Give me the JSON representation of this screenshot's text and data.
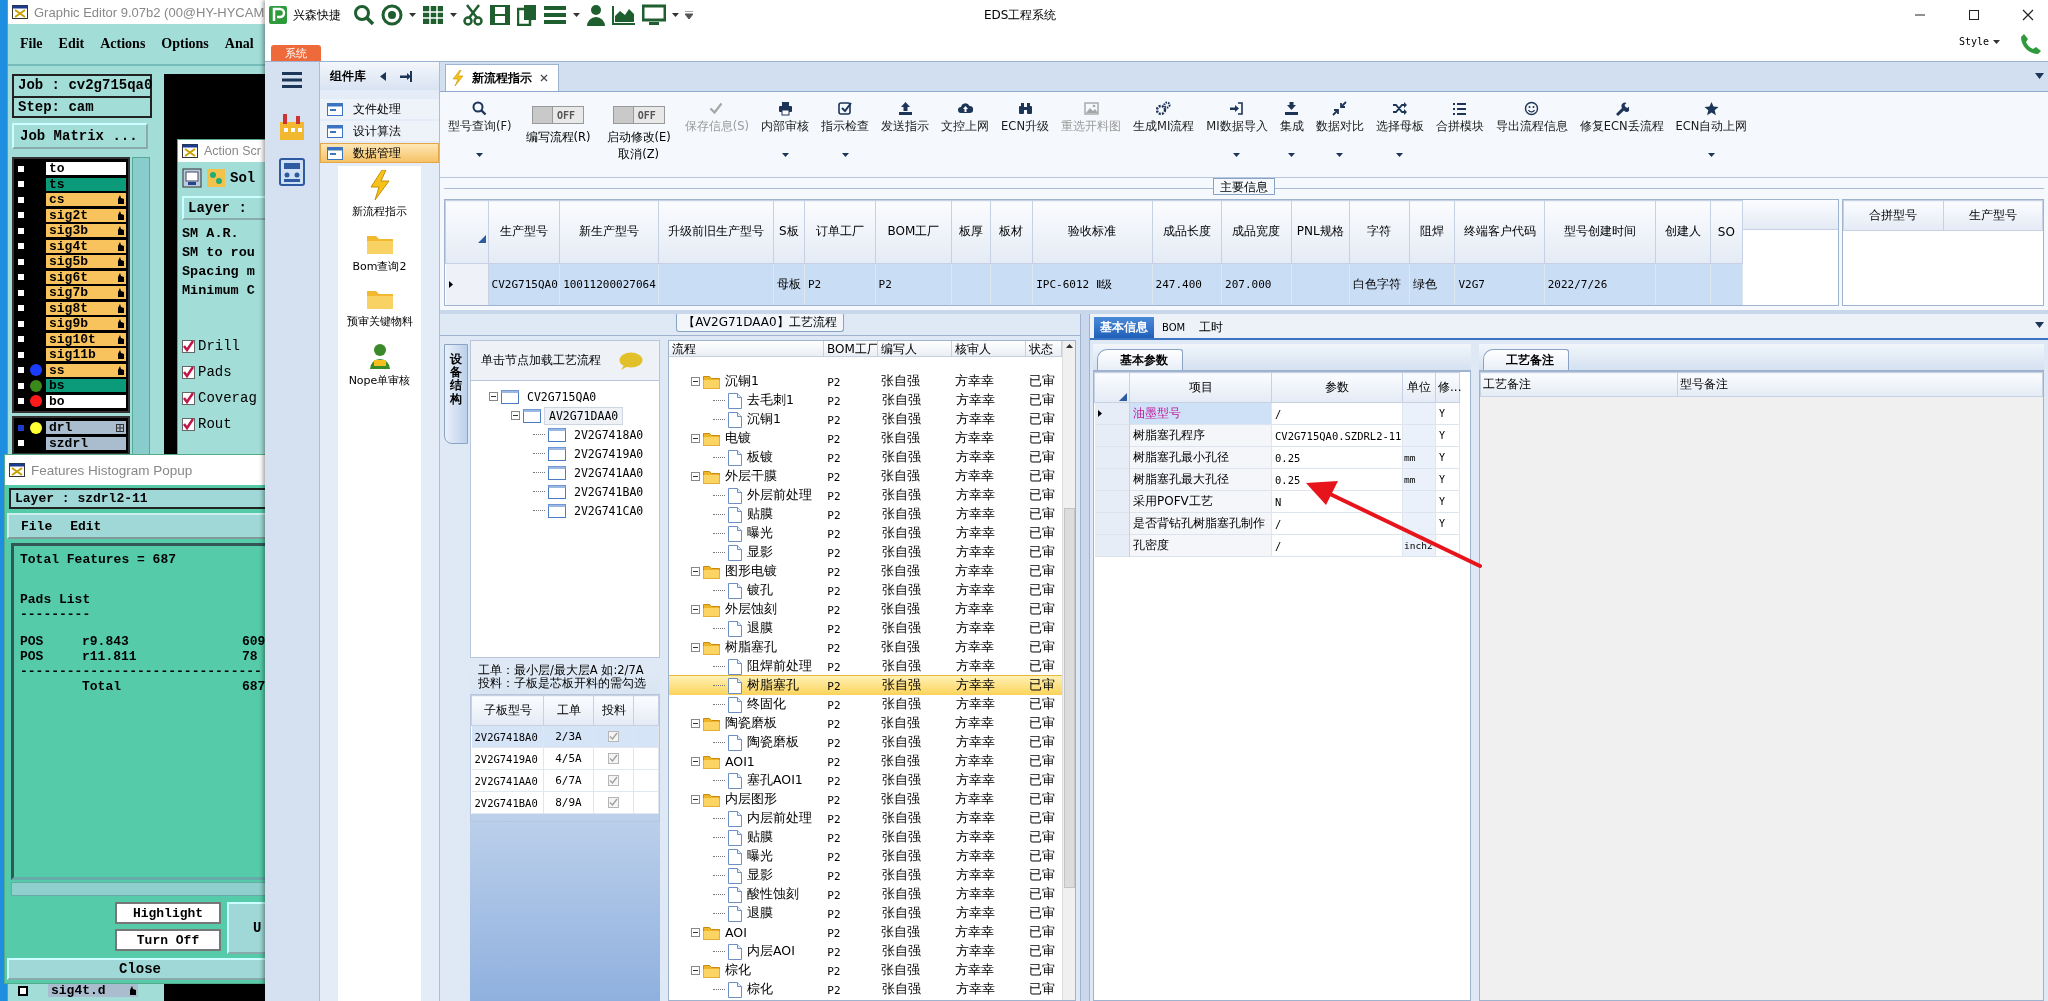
{
  "graphic_editor": {
    "title": "Graphic Editor 9.07b2 (00@HY-HYCAM",
    "menu": [
      "File",
      "Edit",
      "Actions",
      "Options",
      "Anal"
    ],
    "job": "Job : cv2g715qa0",
    "step": "Step: cam",
    "job_matrix_button": "Job Matrix ...",
    "layers": [
      {
        "name": "to",
        "color": "#ffffff",
        "kind": "plain",
        "selected": false
      },
      {
        "name": "ts",
        "color": "#0b9b7a",
        "kind": "plain",
        "selected": false
      },
      {
        "name": "cs",
        "color": "#f8c35c",
        "kind": "signal",
        "selected": false
      },
      {
        "name": "sig2t",
        "color": "#f8c35c",
        "kind": "signal",
        "selected": false
      },
      {
        "name": "sig3b",
        "color": "#f8c35c",
        "kind": "signal",
        "selected": false
      },
      {
        "name": "sig4t",
        "color": "#f8c35c",
        "kind": "signal",
        "selected": false
      },
      {
        "name": "sig5b",
        "color": "#f8c35c",
        "kind": "signal",
        "selected": false
      },
      {
        "name": "sig6t",
        "color": "#f8c35c",
        "kind": "signal",
        "selected": false
      },
      {
        "name": "sig7b",
        "color": "#f8c35c",
        "kind": "signal",
        "selected": false
      },
      {
        "name": "sig8t",
        "color": "#f8c35c",
        "kind": "signal",
        "selected": false
      },
      {
        "name": "sig9b",
        "color": "#f8c35c",
        "kind": "signal",
        "selected": false
      },
      {
        "name": "sig10t",
        "color": "#f8c35c",
        "kind": "signal",
        "selected": false
      },
      {
        "name": "sig11b",
        "color": "#f8c35c",
        "kind": "signal",
        "selected": false
      },
      {
        "name": "ss",
        "color": "#f8c35c",
        "dot": {
          "color": "#1a3cff"
        },
        "kind": "signal",
        "selected": false
      },
      {
        "name": "bs",
        "color": "#0b9b7a",
        "dot": {
          "color": "#3a8a1a"
        },
        "kind": "plain",
        "selected": false
      },
      {
        "name": "bo",
        "color": "#ffffff",
        "dot": {
          "color": "#ff1a1a"
        },
        "kind": "plain",
        "selected": false
      }
    ],
    "drill_layers": [
      {
        "name": "drl",
        "color": "#aabdcf",
        "dot": {
          "color": "#ffff33"
        },
        "kind": "drill",
        "selected": true
      },
      {
        "name": "szdrl",
        "color": "#aabdcf",
        "kind": "plain",
        "selected": false
      }
    ],
    "bottom_layer": {
      "name": "sig4t.d",
      "color": "#aabdcf",
      "kind": "signal",
      "selected": false
    }
  },
  "action_script": {
    "title": "Action Scr",
    "tool_label": "Sol",
    "layer_label": "Layer :",
    "lines": [
      "SM A.R.",
      "SM to rou",
      "Spacing m",
      "Minimum C"
    ],
    "options": [
      {
        "label": "Drill",
        "checked": true
      },
      {
        "label": "Pads",
        "checked": true
      },
      {
        "label": "Coverag",
        "checked": true
      },
      {
        "label": "Rout",
        "checked": true
      }
    ]
  },
  "histogram": {
    "title": "Features Histogram Popup",
    "layer": "Layer :  szdrl2-11",
    "menu": [
      "File",
      "Edit"
    ],
    "total": "Total Features = 687",
    "section": "Pads List",
    "underline": "---------",
    "rows": [
      {
        "type": "POS",
        "size": "r9.843",
        "count": "609"
      },
      {
        "type": "POS",
        "size": "r11.811",
        "count": "78"
      }
    ],
    "separator": "-------------------------------",
    "total_label": "Total",
    "total_count": "687",
    "buttons": [
      "Highlight",
      "Turn Off"
    ],
    "side_button": "U",
    "close_button": "Close"
  },
  "eds": {
    "quick_bar_label": "兴森快捷",
    "title": "EDS工程系统",
    "system_tab": "系统",
    "style_menu": "Style",
    "component_library": {
      "title": "组件库",
      "categories": [
        {
          "label": "文件处理",
          "selected": false
        },
        {
          "label": "设计算法",
          "selected": false
        },
        {
          "label": "数据管理",
          "selected": true
        }
      ],
      "tools": [
        {
          "label": "新流程指示"
        },
        {
          "label": "Bom查询2"
        },
        {
          "label": "预审关键物料"
        },
        {
          "label": "Nope单审核"
        }
      ]
    },
    "doc_tabs": [
      {
        "label": "新流程指示",
        "selected": true
      }
    ],
    "toolbar": [
      {
        "kind": "button",
        "label": "型号查询(F)",
        "dropdown": true,
        "disabled": false
      },
      {
        "kind": "toggle",
        "label": "编写流程(R)",
        "state_label": "OFF",
        "on": false
      },
      {
        "kind": "toggle",
        "label": "启动修改(E)",
        "sublabel": "取消(Z)",
        "state_label": "OFF",
        "on": false
      },
      {
        "kind": "button",
        "label": "保存信息(S)",
        "dropdown": false,
        "disabled": true
      },
      {
        "kind": "button",
        "label": "内部审核",
        "dropdown": true,
        "disabled": false
      },
      {
        "kind": "button",
        "label": "指示检查",
        "dropdown": true,
        "disabled": false
      },
      {
        "kind": "button",
        "label": "发送指示",
        "dropdown": false,
        "disabled": false
      },
      {
        "kind": "button",
        "label": "文控上网",
        "dropdown": false,
        "disabled": false
      },
      {
        "kind": "button",
        "label": "ECN升级",
        "dropdown": false,
        "disabled": false
      },
      {
        "kind": "button",
        "label": "重选开料图",
        "dropdown": false,
        "disabled": true
      },
      {
        "kind": "button",
        "label": "生成MI流程",
        "dropdown": false,
        "disabled": false
      },
      {
        "kind": "button",
        "label": "MI数据导入",
        "dropdown": true,
        "disabled": false
      },
      {
        "kind": "button",
        "label": "集成",
        "dropdown": true,
        "disabled": false
      },
      {
        "kind": "button",
        "label": "数据对比",
        "dropdown": true,
        "disabled": false
      },
      {
        "kind": "button",
        "label": "选择母板",
        "dropdown": true,
        "disabled": false
      },
      {
        "kind": "button",
        "label": "合拼模块",
        "dropdown": false,
        "disabled": false
      },
      {
        "kind": "button",
        "label": "导出流程信息",
        "dropdown": false,
        "disabled": false
      },
      {
        "kind": "button",
        "label": "修复ECN丢流程",
        "dropdown": false,
        "disabled": false
      },
      {
        "kind": "button",
        "label": "ECN自动上网",
        "dropdown": true,
        "disabled": false
      }
    ],
    "main_info": {
      "title": "主要信息",
      "columns": [
        "生产型号",
        "新生产型号",
        "升级前旧生产型号",
        "S板",
        "订单工厂",
        "BOM工厂",
        "板厚",
        "板材",
        "验收标准",
        "成品长度",
        "成品宽度",
        "PNL规格",
        "字符",
        "阻焊",
        "终端客户代码",
        "型号创建时间",
        "创建人",
        "SO"
      ],
      "rows": [
        {
          "selected": true,
          "cells": [
            "CV2G715QA0",
            "10011200027064",
            null,
            "母板",
            "P2",
            "P2",
            null,
            null,
            "IPC-6012 Ⅱ级",
            "247.400",
            "207.000",
            null,
            "白色字符",
            "绿色",
            "V2G7",
            "2022/7/26",
            null,
            null
          ]
        }
      ],
      "side_columns": [
        "合拼型号",
        "生产型号"
      ]
    },
    "process_title": "【AV2G71DAA0】工艺流程",
    "device_panel": {
      "tab": "设备结构",
      "hint": "单击节点加载工艺流程",
      "tree": [
        {
          "label": "CV2G715QA0",
          "selected": false,
          "expanded": true,
          "children": [
            {
              "label": "AV2G71DAA0",
              "selected": true,
              "expanded": true,
              "children": [
                {
                  "label": "2V2G7418A0",
                  "selected": false
                },
                {
                  "label": "2V2G7419A0",
                  "selected": false
                },
                {
                  "label": "2V2G741AA0",
                  "selected": false
                },
                {
                  "label": "2V2G741BA0",
                  "selected": false
                },
                {
                  "label": "2V2G741CA0",
                  "selected": false
                }
              ]
            }
          ]
        }
      ],
      "notes": [
        "工单：最小层/最大层A 如:2/7A",
        "投料：子板是芯板开料的需勾选"
      ],
      "board_columns": [
        "子板型号",
        "工单",
        "投料"
      ],
      "boards": [
        {
          "model": "2V2G7418A0",
          "order": "2/3A",
          "feed": true,
          "selected": true
        },
        {
          "model": "2V2G7419A0",
          "order": "4/5A",
          "feed": true,
          "selected": false
        },
        {
          "model": "2V2G741AA0",
          "order": "6/7A",
          "feed": true,
          "selected": false
        },
        {
          "model": "2V2G741BA0",
          "order": "8/9A",
          "feed": true,
          "selected": false
        }
      ]
    },
    "flow": {
      "columns": [
        "流程",
        "BOM工厂",
        "编写人",
        "核审人",
        "状态"
      ],
      "steps": [
        {
          "name": "沉铜1",
          "bom": "P2",
          "writer": "张自强",
          "reviewer": "方幸幸",
          "status": "已审",
          "selected": false,
          "expanded": true,
          "children": [
            {
              "name": "去毛刺1",
              "bom": "P2",
              "writer": "张自强",
              "reviewer": "方幸幸",
              "status": "已审",
              "selected": false
            },
            {
              "name": "沉铜1",
              "bom": "P2",
              "writer": "张自强",
              "reviewer": "方幸幸",
              "status": "已审",
              "selected": false
            }
          ]
        },
        {
          "name": "电镀",
          "bom": "P2",
          "writer": "张自强",
          "reviewer": "方幸幸",
          "status": "已审",
          "selected": false,
          "expanded": true,
          "children": [
            {
              "name": "板镀",
              "bom": "P2",
              "writer": "张自强",
              "reviewer": "方幸幸",
              "status": "已审",
              "selected": false
            }
          ]
        },
        {
          "name": "外层干膜",
          "bom": "P2",
          "writer": "张自强",
          "reviewer": "方幸幸",
          "status": "已审",
          "selected": false,
          "expanded": true,
          "children": [
            {
              "name": "外层前处理",
              "bom": "P2",
              "writer": "张自强",
              "reviewer": "方幸幸",
              "status": "已审",
              "selected": false
            },
            {
              "name": "贴膜",
              "bom": "P2",
              "writer": "张自强",
              "reviewer": "方幸幸",
              "status": "已审",
              "selected": false
            },
            {
              "name": "曝光",
              "bom": "P2",
              "writer": "张自强",
              "reviewer": "方幸幸",
              "status": "已审",
              "selected": false
            },
            {
              "name": "显影",
              "bom": "P2",
              "writer": "张自强",
              "reviewer": "方幸幸",
              "status": "已审",
              "selected": false
            }
          ]
        },
        {
          "name": "图形电镀",
          "bom": "P2",
          "writer": "张自强",
          "reviewer": "方幸幸",
          "status": "已审",
          "selected": false,
          "expanded": true,
          "children": [
            {
              "name": "镀孔",
              "bom": "P2",
              "writer": "张自强",
              "reviewer": "方幸幸",
              "status": "已审",
              "selected": false
            }
          ]
        },
        {
          "name": "外层蚀刻",
          "bom": "P2",
          "writer": "张自强",
          "reviewer": "方幸幸",
          "status": "已审",
          "selected": false,
          "expanded": true,
          "children": [
            {
              "name": "退膜",
              "bom": "P2",
              "writer": "张自强",
              "reviewer": "方幸幸",
              "status": "已审",
              "selected": false
            }
          ]
        },
        {
          "name": "树脂塞孔",
          "bom": "P2",
          "writer": "张自强",
          "reviewer": "方幸幸",
          "status": "已审",
          "selected": false,
          "expanded": true,
          "children": [
            {
              "name": "阻焊前处理",
              "bom": "P2",
              "writer": "张自强",
              "reviewer": "方幸幸",
              "status": "已审",
              "selected": false
            },
            {
              "name": "树脂塞孔",
              "bom": "P2",
              "writer": "张自强",
              "reviewer": "方幸幸",
              "status": "已审",
              "selected": true
            },
            {
              "name": "终固化",
              "bom": "P2",
              "writer": "张自强",
              "reviewer": "方幸幸",
              "status": "已审",
              "selected": false
            }
          ]
        },
        {
          "name": "陶瓷磨板",
          "bom": "P2",
          "writer": "张自强",
          "reviewer": "方幸幸",
          "status": "已审",
          "selected": false,
          "expanded": true,
          "children": [
            {
              "name": "陶瓷磨板",
              "bom": "P2",
              "writer": "张自强",
              "reviewer": "方幸幸",
              "status": "已审",
              "selected": false
            }
          ]
        },
        {
          "name": "AOI1",
          "bom": "P2",
          "writer": "张自强",
          "reviewer": "方幸幸",
          "status": "已审",
          "selected": false,
          "expanded": true,
          "children": [
            {
              "name": "塞孔AOI1",
              "bom": "P2",
              "writer": "张自强",
              "reviewer": "方幸幸",
              "status": "已审",
              "selected": false
            }
          ]
        },
        {
          "name": "内层图形",
          "bom": "P2",
          "writer": "张自强",
          "reviewer": "方幸幸",
          "status": "已审",
          "selected": false,
          "expanded": true,
          "children": [
            {
              "name": "内层前处理",
              "bom": "P2",
              "writer": "张自强",
              "reviewer": "方幸幸",
              "status": "已审",
              "selected": false
            },
            {
              "name": "贴膜",
              "bom": "P2",
              "writer": "张自强",
              "reviewer": "方幸幸",
              "status": "已审",
              "selected": false
            },
            {
              "name": "曝光",
              "bom": "P2",
              "writer": "张自强",
              "reviewer": "方幸幸",
              "status": "已审",
              "selected": false
            },
            {
              "name": "显影",
              "bom": "P2",
              "writer": "张自强",
              "reviewer": "方幸幸",
              "status": "已审",
              "selected": false
            },
            {
              "name": "酸性蚀刻",
              "bom": "P2",
              "writer": "张自强",
              "reviewer": "方幸幸",
              "status": "已审",
              "selected": false
            },
            {
              "name": "退膜",
              "bom": "P2",
              "writer": "张自强",
              "reviewer": "方幸幸",
              "status": "已审",
              "selected": false
            }
          ]
        },
        {
          "name": "AOI",
          "bom": "P2",
          "writer": "张自强",
          "reviewer": "方幸幸",
          "status": "已审",
          "selected": false,
          "expanded": true,
          "children": [
            {
              "name": "内层AOI",
              "bom": "P2",
              "writer": "张自强",
              "reviewer": "方幸幸",
              "status": "已审",
              "selected": false
            }
          ]
        },
        {
          "name": "棕化",
          "bom": "P2",
          "writer": "张自强",
          "reviewer": "方幸幸",
          "status": "已审",
          "selected": false,
          "expanded": true,
          "children": [
            {
              "name": "棕化",
              "bom": "P2",
              "writer": "张自强",
              "reviewer": "方幸幸",
              "status": "已审",
              "selected": false
            }
          ]
        }
      ]
    },
    "detail": {
      "tabs": [
        {
          "label": "基本信息",
          "selected": true
        },
        {
          "label": "BOM",
          "selected": false
        },
        {
          "label": "工时",
          "selected": false
        }
      ],
      "sub_tab": "基本参数",
      "columns": [
        "项目",
        "参数",
        "单位",
        "修..."
      ],
      "params": [
        {
          "item": "油墨型号",
          "value": "/",
          "flag": "Y",
          "selected": true
        },
        {
          "item": "树脂塞孔程序",
          "value": "CV2G715QA0.SZDRL2-11",
          "flag": "Y",
          "selected": false
        },
        {
          "item": "树脂塞孔最小孔径",
          "value": "0.25",
          "unit": "mm",
          "flag": "Y",
          "selected": false
        },
        {
          "item": "树脂塞孔最大孔径",
          "value": "0.25",
          "unit": "mm",
          "flag": "Y",
          "selected": false
        },
        {
          "item": "采用POFV工艺",
          "value": "N",
          "flag": "Y",
          "selected": false
        },
        {
          "item": "是否背钻孔树脂塞孔制作",
          "value": "/",
          "flag": "Y",
          "selected": false
        },
        {
          "item": "孔密度",
          "value": "/",
          "unit": "inch2",
          "selected": false
        }
      ],
      "notes_tab": "工艺备注",
      "notes_columns": [
        "工艺备注",
        "型号备注"
      ]
    }
  }
}
